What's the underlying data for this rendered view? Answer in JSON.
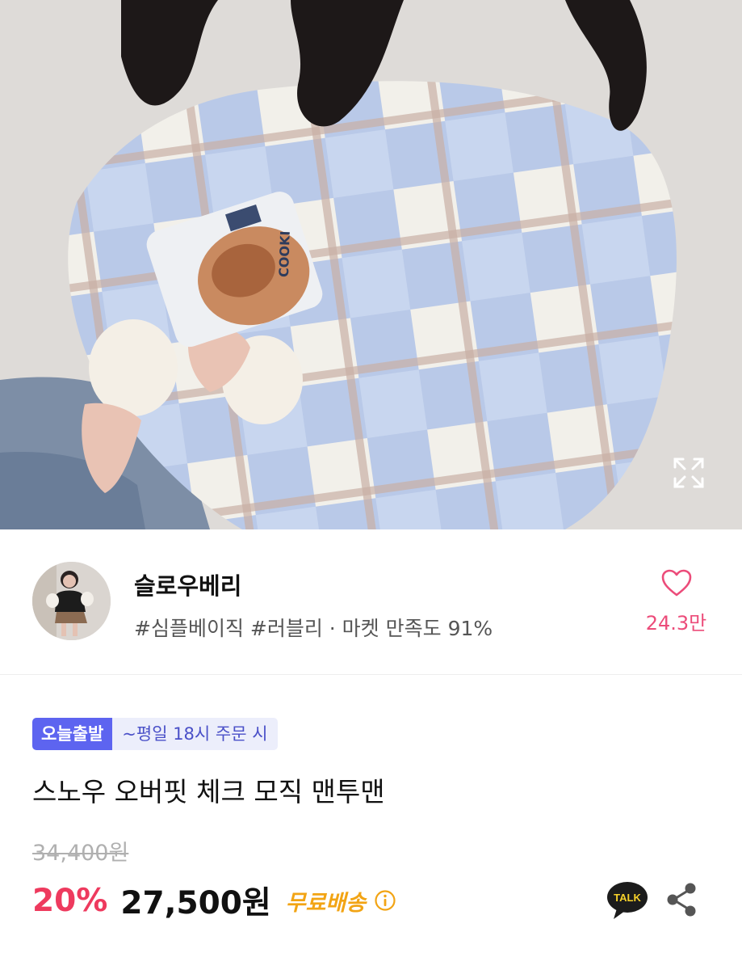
{
  "hero": {
    "image_icon": "product-photo-checked-sweater",
    "expand_icon": "fullscreen-expand-icon",
    "cookie_bag_text": "COOKI"
  },
  "seller": {
    "name": "슬로우베리",
    "tags": "#심플베이직 #러블리 · 마켓 만족도 91%",
    "like_count": "24.3만",
    "like_icon": "heart-outline-icon",
    "accent_color": "#ec4c7a"
  },
  "product": {
    "delivery_badge": "오늘출발",
    "delivery_note": "~평일 18시 주문 시",
    "title": "스노우 오버핏 체크 모직 맨투맨",
    "original_price": "34,400원",
    "discount": "20%",
    "price": "27,500원",
    "shipping": "무료배송",
    "talk_label": "TALK",
    "colors": {
      "discount": "#ee3a5e",
      "shipping": "#f2a414",
      "badge": "#5d64f0"
    }
  }
}
